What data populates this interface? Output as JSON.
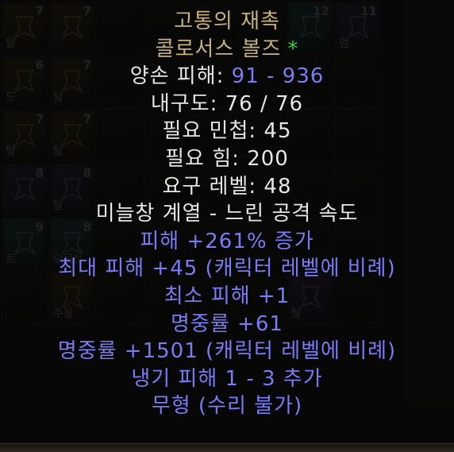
{
  "inventory": {
    "slots": [
      {
        "qty": "7",
        "tag": "탈",
        "kind": "rune-gold"
      },
      {
        "qty": "7",
        "tag": "",
        "kind": "rune-gold"
      },
      {
        "qty": "",
        "tag": "",
        "kind": ""
      },
      {
        "qty": "",
        "tag": "",
        "kind": ""
      },
      {
        "qty": "",
        "tag": "",
        "kind": ""
      },
      {
        "qty": "",
        "tag": "",
        "kind": ""
      },
      {
        "qty": "12",
        "tag": "",
        "kind": "rune-teal"
      },
      {
        "qty": "11",
        "tag": "앰",
        "kind": "rune-purple"
      },
      {
        "qty": "6",
        "tag": "드",
        "kind": "rune-gold"
      },
      {
        "qty": "7",
        "tag": "탈",
        "kind": "rune-gold"
      },
      {
        "qty": "",
        "tag": "",
        "kind": ""
      },
      {
        "qty": "",
        "tag": "",
        "kind": ""
      },
      {
        "qty": "",
        "tag": "",
        "kind": ""
      },
      {
        "qty": "",
        "tag": "",
        "kind": ""
      },
      {
        "qty": "",
        "tag": "",
        "kind": ""
      },
      {
        "qty": "",
        "tag": "",
        "kind": ""
      },
      {
        "qty": "7",
        "tag": "탈",
        "kind": "rune-gold"
      },
      {
        "qty": "7",
        "tag": "탈",
        "kind": "rune-gold"
      },
      {
        "qty": "",
        "tag": "",
        "kind": ""
      },
      {
        "qty": "",
        "tag": "",
        "kind": ""
      },
      {
        "qty": "",
        "tag": "",
        "kind": ""
      },
      {
        "qty": "",
        "tag": "",
        "kind": ""
      },
      {
        "qty": "",
        "tag": "",
        "kind": ""
      },
      {
        "qty": "",
        "tag": "",
        "kind": ""
      },
      {
        "qty": "8",
        "tag": "",
        "kind": "rune-purple"
      },
      {
        "qty": "8",
        "tag": "탈",
        "kind": "rune-purple"
      },
      {
        "qty": "",
        "tag": "",
        "kind": ""
      },
      {
        "qty": "",
        "tag": "",
        "kind": ""
      },
      {
        "qty": "",
        "tag": "",
        "kind": ""
      },
      {
        "qty": "",
        "tag": "",
        "kind": ""
      },
      {
        "qty": "",
        "tag": "",
        "kind": ""
      },
      {
        "qty": "",
        "tag": "",
        "kind": ""
      },
      {
        "qty": "9",
        "tag": "트",
        "kind": "rune-teal"
      },
      {
        "qty": "8",
        "tag": "오르트",
        "kind": "rune-teal"
      },
      {
        "qty": "",
        "tag": "",
        "kind": ""
      },
      {
        "qty": "",
        "tag": "",
        "kind": ""
      },
      {
        "qty": "",
        "tag": "",
        "kind": ""
      },
      {
        "qty": "",
        "tag": "",
        "kind": ""
      },
      {
        "qty": "",
        "tag": "",
        "kind": ""
      },
      {
        "qty": "",
        "tag": "",
        "kind": ""
      },
      {
        "qty": "",
        "tag": "",
        "kind": ""
      },
      {
        "qty": "",
        "tag": "주울",
        "kind": "rune-gold"
      },
      {
        "qty": "",
        "tag": "",
        "kind": ""
      },
      {
        "qty": "",
        "tag": "",
        "kind": ""
      },
      {
        "qty": "",
        "tag": "",
        "kind": ""
      },
      {
        "qty": "",
        "tag": "",
        "kind": ""
      },
      {
        "qty": "",
        "tag": "탈",
        "kind": "rune-purple"
      },
      {
        "qty": "",
        "tag": "",
        "kind": ""
      }
    ]
  },
  "tooltip": {
    "item_name": "고통의 재촉",
    "item_base": "콜로서스 볼즈",
    "socket_marker": "*",
    "lines": [
      {
        "text": "양손 피해: ",
        "value": "91 - 936",
        "style": "white"
      },
      {
        "text": "내구도: 76 / 76",
        "value": "",
        "style": "white"
      },
      {
        "text": "필요 민첩: 45",
        "value": "",
        "style": "white"
      },
      {
        "text": "필요 힘: 200",
        "value": "",
        "style": "white"
      },
      {
        "text": "요구 레벨: 48",
        "value": "",
        "style": "white"
      },
      {
        "text": "미늘창 계열 - 느린 공격 속도",
        "value": "",
        "style": "white"
      },
      {
        "text": "피해 +261% 증가",
        "value": "",
        "style": "magic"
      },
      {
        "text": "최대 피해 +45 (캐릭터 레벨에 비례)",
        "value": "",
        "style": "magic"
      },
      {
        "text": "최소 피해 +1",
        "value": "",
        "style": "magic"
      },
      {
        "text": "명중률 +61",
        "value": "",
        "style": "magic"
      },
      {
        "text": "명중률 +1501 (캐릭터 레벨에 비례)",
        "value": "",
        "style": "magic"
      },
      {
        "text": "냉기 피해 1 - 3 추가",
        "value": "",
        "style": "magic"
      },
      {
        "text": "무형 (수리 불가)",
        "value": "",
        "style": "magic"
      }
    ]
  },
  "colors": {
    "unique": "#c7b377",
    "white": "#e6e6e6",
    "magic": "#7a7cf5",
    "socket": "#31d331"
  }
}
